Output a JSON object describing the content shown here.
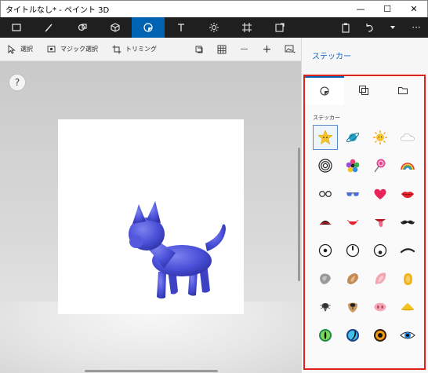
{
  "window": {
    "title": "タイトルなし* - ペイント 3D",
    "minimize": "—",
    "maximize": "☐",
    "close": "✕"
  },
  "toolbar": {
    "tools": [
      "menu-icon",
      "brushes-icon",
      "2d-shapes-icon",
      "3d-shapes-icon",
      "stickers-icon",
      "text-icon",
      "effects-icon",
      "canvas-icon",
      "3d-library-icon"
    ],
    "active_tool": "stickers-icon",
    "paste_icon": "paste-icon",
    "undo_icon": "undo-icon",
    "history_icon": "chevron-down-icon",
    "more_label": "···"
  },
  "subtoolbar": {
    "select_label": "選択",
    "magic_select_label": "マジック選択",
    "crop_label": "トリミング",
    "zoom_out": "—",
    "zoom_in": "+"
  },
  "canvas": {
    "help_label": "?",
    "object": "blue-3d-cat"
  },
  "panel": {
    "title": "ステッカー",
    "tabs": [
      "stickers-tab",
      "textures-tab",
      "custom-sticker-tab"
    ],
    "category_label": "ステッカー",
    "stickers": [
      "star-face",
      "planet",
      "sun-face",
      "cloud-face",
      "spiral",
      "flower",
      "lollipop",
      "rainbow",
      "glasses",
      "sunglasses",
      "heart",
      "lips",
      "open-mouth",
      "grin-mouth",
      "tongue-mouth",
      "mustache",
      "eye-dot",
      "eye-look-up",
      "eye-look-down",
      "eyebrow",
      "grey-ear",
      "brown-ear",
      "pink-ear",
      "yellow-ear",
      "bee-nose",
      "dog-nose",
      "pig-nose",
      "yellow-beak",
      "green-cat-eye",
      "blue-cat-eye",
      "orange-eye",
      "dark-eye"
    ],
    "selected_sticker": "star-face"
  },
  "colors": {
    "accent": "#0063b1",
    "panel_title": "#0e63b6",
    "highlight_box": "#e0201f",
    "toolbar_bg": "#1f1f1f",
    "cat": "#4a50d8"
  }
}
